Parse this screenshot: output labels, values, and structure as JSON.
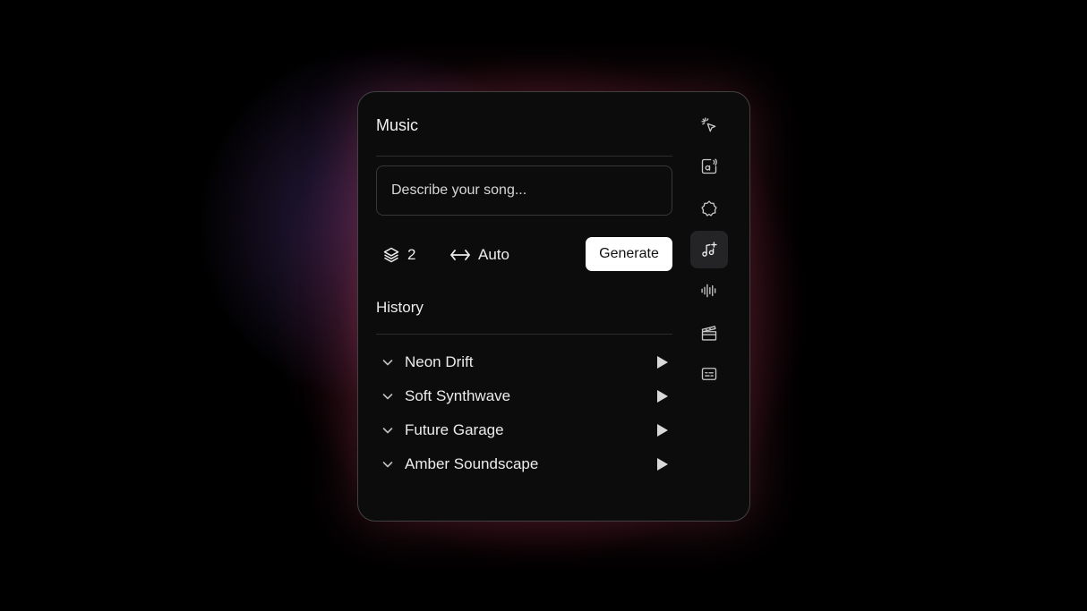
{
  "panel": {
    "title": "Music",
    "prompt_placeholder": "Describe your song...",
    "controls": {
      "layers_icon": "layers-icon",
      "layers_value": "2",
      "duration_icon": "arrows-horizontal-icon",
      "duration_value": "Auto",
      "generate_label": "Generate"
    },
    "history": {
      "title": "History",
      "items": [
        {
          "name": "Neon Drift"
        },
        {
          "name": "Soft Synthwave"
        },
        {
          "name": "Future Garage"
        },
        {
          "name": "Amber Soundscape"
        }
      ]
    }
  },
  "sidebar": {
    "items": [
      {
        "icon": "magic-cursor-icon",
        "active": false
      },
      {
        "icon": "text-to-speech-icon",
        "active": false
      },
      {
        "icon": "sound-effects-icon",
        "active": false
      },
      {
        "icon": "music-add-icon",
        "active": true
      },
      {
        "icon": "waveform-icon",
        "active": false
      },
      {
        "icon": "clapperboard-icon",
        "active": false
      },
      {
        "icon": "captions-icon",
        "active": false
      }
    ]
  },
  "colors": {
    "background": "#000000",
    "panel": "#0c0c0d",
    "glow": "#a83c50",
    "button": "#ffffff",
    "active_sidebar": "#242426"
  }
}
